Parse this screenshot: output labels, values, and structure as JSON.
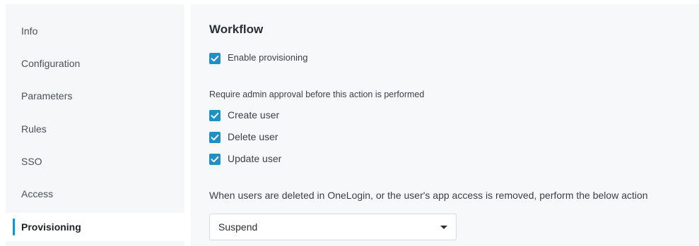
{
  "sidebar": {
    "items": [
      {
        "label": "Info"
      },
      {
        "label": "Configuration"
      },
      {
        "label": "Parameters"
      },
      {
        "label": "Rules"
      },
      {
        "label": "SSO"
      },
      {
        "label": "Access"
      },
      {
        "label": "Provisioning"
      }
    ],
    "active_item": "Provisioning"
  },
  "workflow": {
    "title": "Workflow",
    "enable_provisioning": {
      "label": "Enable provisioning",
      "checked": true
    },
    "approval_heading": "Require admin approval before this action is performed",
    "approvals": [
      {
        "label": "Create user",
        "checked": true
      },
      {
        "label": "Delete user",
        "checked": true
      },
      {
        "label": "Update user",
        "checked": true
      }
    ],
    "deletion_action_text": "When users are deleted in OneLogin, or the user's app access is removed, perform the below action",
    "deletion_action_select": {
      "value": "Suspend"
    }
  },
  "colors": {
    "accent": "#1f8fc4",
    "sidebar_bg": "#f6f7f8"
  }
}
